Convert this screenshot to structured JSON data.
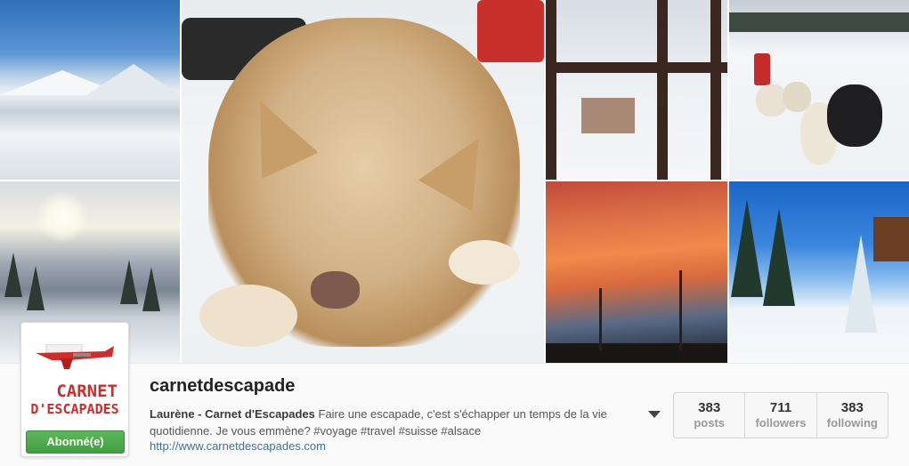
{
  "profile": {
    "username": "carnetdescapade",
    "bio_name": "Laurène - Carnet d'Escapades",
    "bio_text": " Faire une escapade, c'est s'échapper un temps de la vie quotidienne. Je vous emmène? #voyage #travel #suisse #alsace",
    "website": "http://www.carnetdescapades.com",
    "follow_button": "Abonné(e)",
    "logo_line1": "CARNET",
    "logo_line2": "D'ESCAPADES"
  },
  "stats": [
    {
      "value": "383",
      "label": "posts"
    },
    {
      "value": "711",
      "label": "followers"
    },
    {
      "value": "383",
      "label": "following"
    }
  ],
  "colors": {
    "follow_green": "#4cae4c",
    "link_blue": "#3f729b",
    "logo_red": "#d32a2a"
  },
  "icons": {
    "menu_toggle": "chevron-down-icon"
  }
}
